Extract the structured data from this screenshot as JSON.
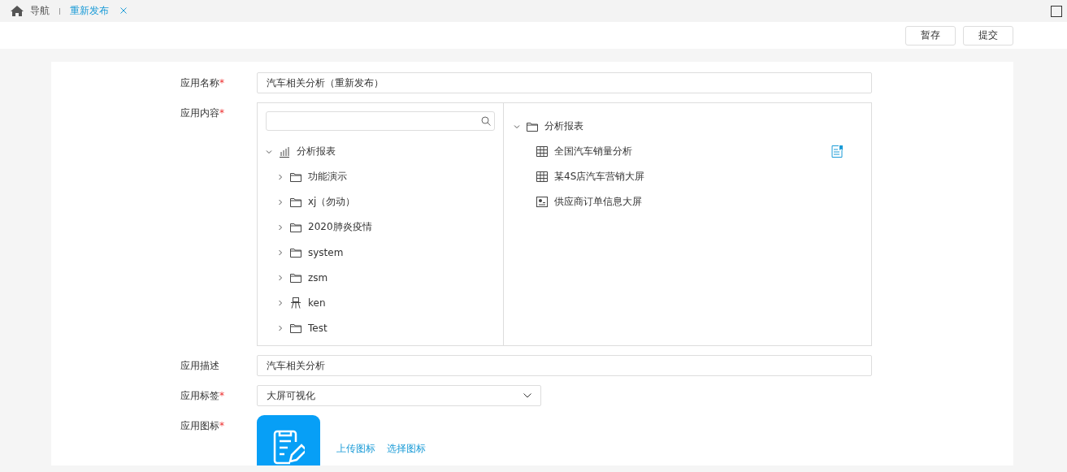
{
  "tabs": {
    "home": "导航",
    "items": [
      {
        "label": "重新发布",
        "selected": true,
        "closable": true
      }
    ]
  },
  "toolbar": {
    "buttons": [
      "暂存",
      "提交"
    ]
  },
  "form": {
    "name": {
      "label": "应用名称",
      "required_mark": "*",
      "value": "汽车相关分析（重新发布）"
    },
    "content": {
      "label": "应用内容",
      "required_mark": "*",
      "source_tree": [
        {
          "label": "分析报表",
          "kind": "chart",
          "expanded": true,
          "children": [
            {
              "label": "功能演示",
              "kind": "folder",
              "expanded": false
            },
            {
              "label": "xj（勿动）",
              "kind": "folder",
              "expanded": false
            },
            {
              "label": "2020肺炎疫情",
              "kind": "folder",
              "expanded": false
            },
            {
              "label": "system",
              "kind": "folder",
              "expanded": false
            },
            {
              "label": "zsm",
              "kind": "folder",
              "expanded": false
            },
            {
              "label": "ken",
              "kind": "user",
              "expanded": false
            },
            {
              "label": "Test",
              "kind": "folder",
              "expanded": false
            }
          ]
        }
      ],
      "chosen_tree": [
        {
          "label": "分析报表",
          "kind": "folder",
          "expanded": true,
          "children": [
            {
              "label": "全国汽车销量分析",
              "kind": "table",
              "selected": true
            },
            {
              "label": "某4S店汽车营销大屏",
              "kind": "table",
              "selected": false
            },
            {
              "label": "供应商订单信息大屏",
              "kind": "screen",
              "selected": false
            }
          ]
        }
      ]
    },
    "description": {
      "label": "应用描述",
      "value": "汽车相关分析"
    },
    "tag": {
      "label": "应用标签",
      "required_mark": "*",
      "value": "大屏可视化"
    },
    "icon": {
      "label": "应用图标",
      "required_mark": "*",
      "links": [
        "上传图标",
        "选择图标"
      ]
    }
  }
}
